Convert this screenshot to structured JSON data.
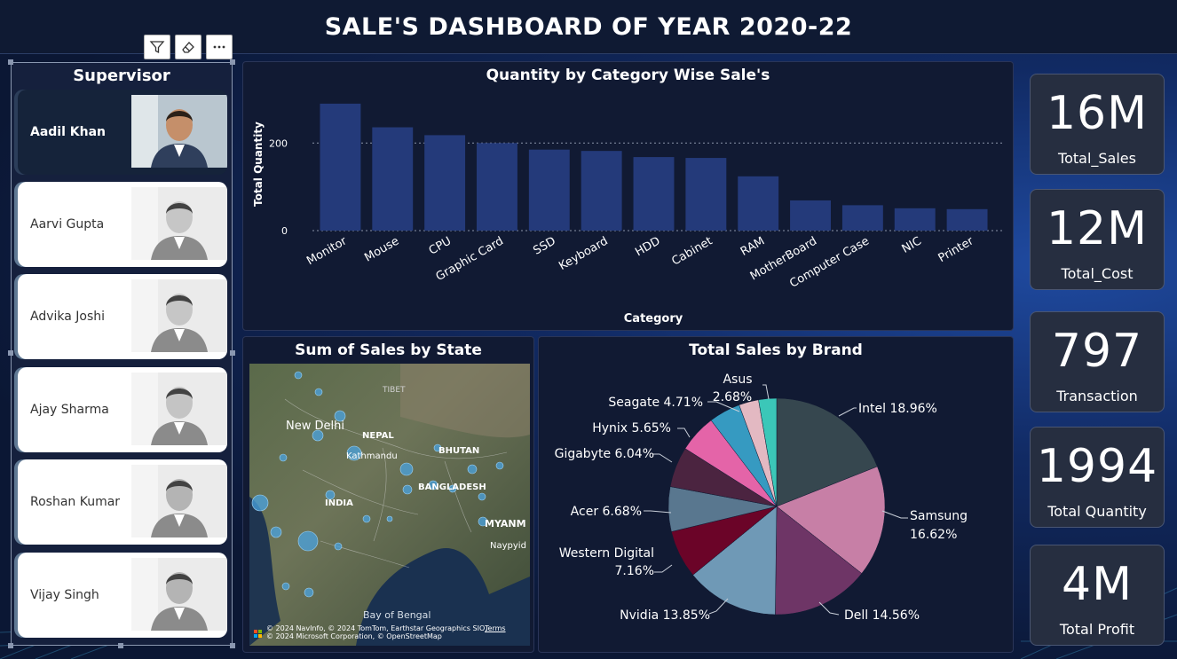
{
  "header": {
    "title": "SALE'S DASHBOARD OF YEAR 2020-22"
  },
  "slicer": {
    "title": "Supervisor",
    "toolbar": {
      "filter_icon": "filter-icon",
      "eraser_icon": "eraser-icon",
      "more_icon": "more-options-icon"
    },
    "items": [
      {
        "name": "Aadil Khan",
        "selected": true
      },
      {
        "name": "Aarvi Gupta",
        "selected": false
      },
      {
        "name": "Advika Joshi",
        "selected": false
      },
      {
        "name": "Ajay Sharma",
        "selected": false
      },
      {
        "name": "Roshan Kumar",
        "selected": false
      },
      {
        "name": "Vijay Singh",
        "selected": false
      }
    ]
  },
  "bar_chart": {
    "title": "Quantity by Category Wise Sale's"
  },
  "map_panel": {
    "title": "Sum of Sales by State",
    "labels": {
      "delhi": "New Delhi",
      "tibet": "TIBET",
      "nepal": "NEPAL",
      "kathmandu": "Kathmandu",
      "bhutan": "BHUTAN",
      "bangladesh": "BANGLADESH",
      "india": "INDIA",
      "myanmar": "MYANM",
      "naypyidaw": "Naypyid",
      "bay": "Bay of Bengal"
    },
    "attribution": "© 2024 NavInfo, © 2024 TomTom, Earthstar Geographics  SIO, © 2024 Microsoft Corporation, © OpenStreetMap",
    "terms": "Terms"
  },
  "pie_panel": {
    "title": "Total Sales by Brand"
  },
  "kpis": [
    {
      "value": "16M",
      "label": "Total_Sales"
    },
    {
      "value": "12M",
      "label": "Total_Cost"
    },
    {
      "value": "797",
      "label": "Transaction"
    },
    {
      "value": "1994",
      "label": "Total  Quantity"
    },
    {
      "value": "4M",
      "label": "Total Profit"
    }
  ],
  "colors": {
    "bar": "#243a7a",
    "background": "#0d1a3a",
    "panel": "#111a33"
  },
  "chart_data": [
    {
      "type": "bar",
      "title": "Quantity by Category Wise Sale's",
      "xlabel": "Category",
      "ylabel": "Total Quantity",
      "categories": [
        "Monitor",
        "Mouse",
        "CPU",
        "Graphic Card",
        "SSD",
        "Keyboard",
        "HDD",
        "Cabinet",
        "RAM",
        "MotherBoard",
        "Computer Case",
        "NIC",
        "Printer"
      ],
      "values": [
        290,
        236,
        218,
        200,
        185,
        182,
        168,
        166,
        124,
        69,
        58,
        51,
        49
      ],
      "yticks": [
        0,
        200
      ],
      "ylim": [
        0,
        310
      ]
    },
    {
      "type": "pie",
      "title": "Total Sales by Brand",
      "slices": [
        {
          "label": "Intel",
          "value": 18.96,
          "color": "#36474f"
        },
        {
          "label": "Samsung",
          "value": 16.62,
          "color": "#c77fa6"
        },
        {
          "label": "Dell",
          "value": 14.56,
          "color": "#6e3566"
        },
        {
          "label": "Nvidia",
          "value": 13.85,
          "color": "#6f99b6"
        },
        {
          "label": "Western Digital",
          "value": 7.16,
          "color": "#6b0428"
        },
        {
          "label": "Acer",
          "value": 6.68,
          "color": "#59778f"
        },
        {
          "label": "Gigabyte",
          "value": 6.04,
          "color": "#4b2440"
        },
        {
          "label": "Hynix",
          "value": 5.65,
          "color": "#e464a8"
        },
        {
          "label": "Seagate",
          "value": 4.71,
          "color": "#369ac1"
        },
        {
          "label": "",
          "value": 2.95,
          "color": "#e3b9c2"
        },
        {
          "label": "Asus",
          "value": 2.68,
          "color": "#3bc7b8"
        }
      ],
      "display_labels": [
        "Intel 18.96%",
        "Samsung",
        "16.62%",
        "Dell 14.56%",
        "Nvidia 13.85%",
        "Western Digital",
        "7.16%",
        "Acer 6.68%",
        "Gigabyte 6.04%",
        "Hynix 5.65%",
        "Seagate 4.71%",
        "Asus",
        "2.68%"
      ]
    }
  ]
}
